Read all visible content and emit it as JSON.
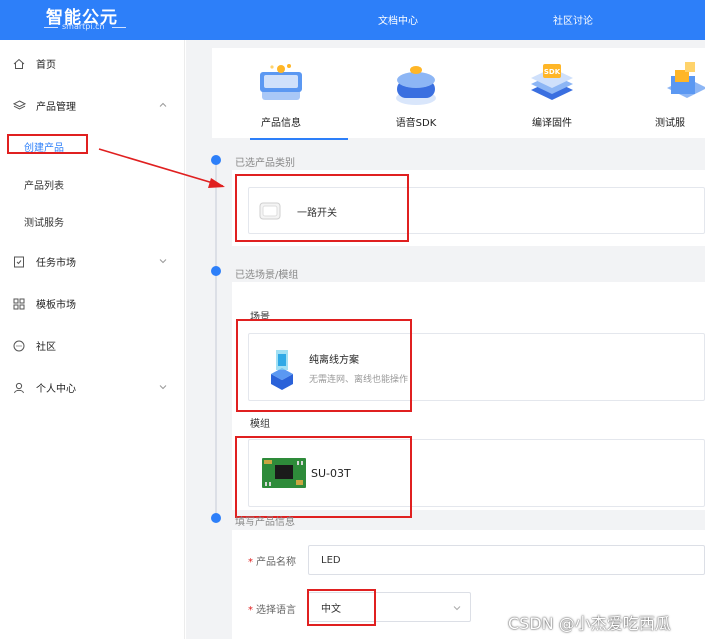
{
  "header": {
    "logo": "智能公元",
    "logo_sub": "smartpi.cn",
    "nav": [
      "文档中心",
      "社区讨论"
    ]
  },
  "sidebar": {
    "home": "首页",
    "product_mgmt": "产品管理",
    "create_product": "创建产品",
    "product_list": "产品列表",
    "test_service": "测试服务",
    "task_market": "任务市场",
    "template_market": "模板市场",
    "community": "社区",
    "personal_center": "个人中心"
  },
  "steps": [
    {
      "label": "产品信息",
      "icon": "product-info-icon"
    },
    {
      "label": "语音SDK",
      "icon": "voice-sdk-icon"
    },
    {
      "label": "编译固件",
      "icon": "compile-firmware-icon"
    },
    {
      "label": "测试服",
      "icon": "test-service-icon"
    }
  ],
  "sdk_badge": "SDK",
  "sections": {
    "category_label": "已选产品类别",
    "category_value": "一路开关",
    "scene_module_label": "已选场景/模组",
    "scene_title": "场景",
    "scene_name": "纯离线方案",
    "scene_desc": "无需连网、离线也能操作",
    "module_title": "模组",
    "module_name": "SU-03T",
    "fill_label": "填写产品信息"
  },
  "form": {
    "name_label": "产品名称",
    "name_value": "LED",
    "lang_label": "选择语言",
    "lang_value": "中文"
  },
  "watermark": "CSDN @小杰爱吃西瓜",
  "colors": {
    "primary": "#2d7ff9",
    "annotation": "#e02020"
  }
}
